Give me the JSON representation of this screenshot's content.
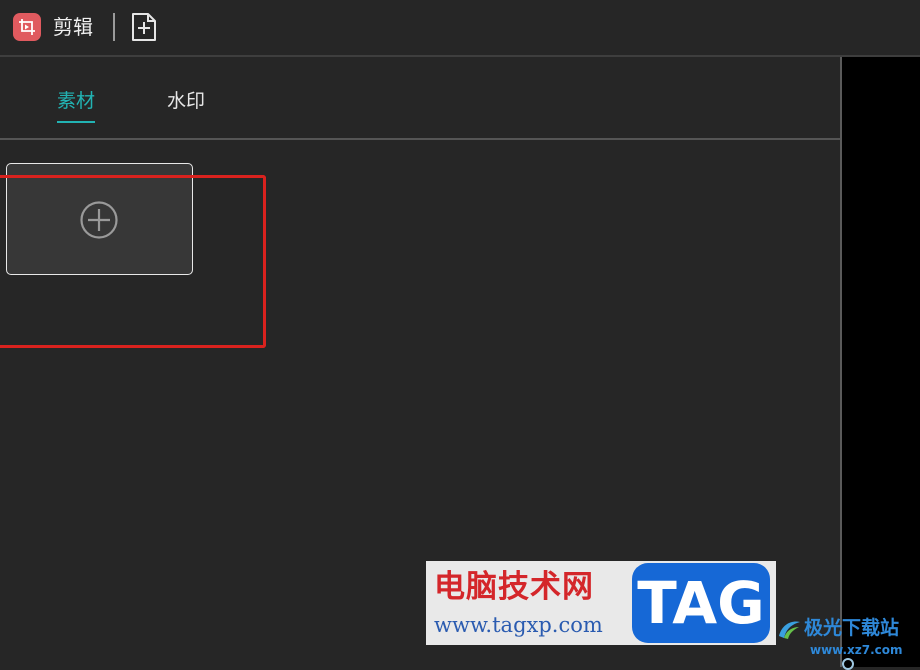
{
  "header": {
    "app_title": "剪辑",
    "new_button_icon": "new-file-icon",
    "app_icon": "video-crop-icon"
  },
  "tabs": [
    {
      "label": "素材",
      "active": true
    },
    {
      "label": "水印",
      "active": false
    }
  ],
  "content": {
    "add_card_icon": "plus-circle-icon"
  },
  "watermark": {
    "cn_text": "电脑技术网",
    "url": "www.tagxp.com",
    "tag": "TAG"
  },
  "site_logo": {
    "text": "极光下载站",
    "url": "www.xz7.com"
  },
  "colors": {
    "accent": "#22b3b3",
    "app_icon": "#e05a5f",
    "highlight": "#d9221e",
    "background": "#262626"
  }
}
